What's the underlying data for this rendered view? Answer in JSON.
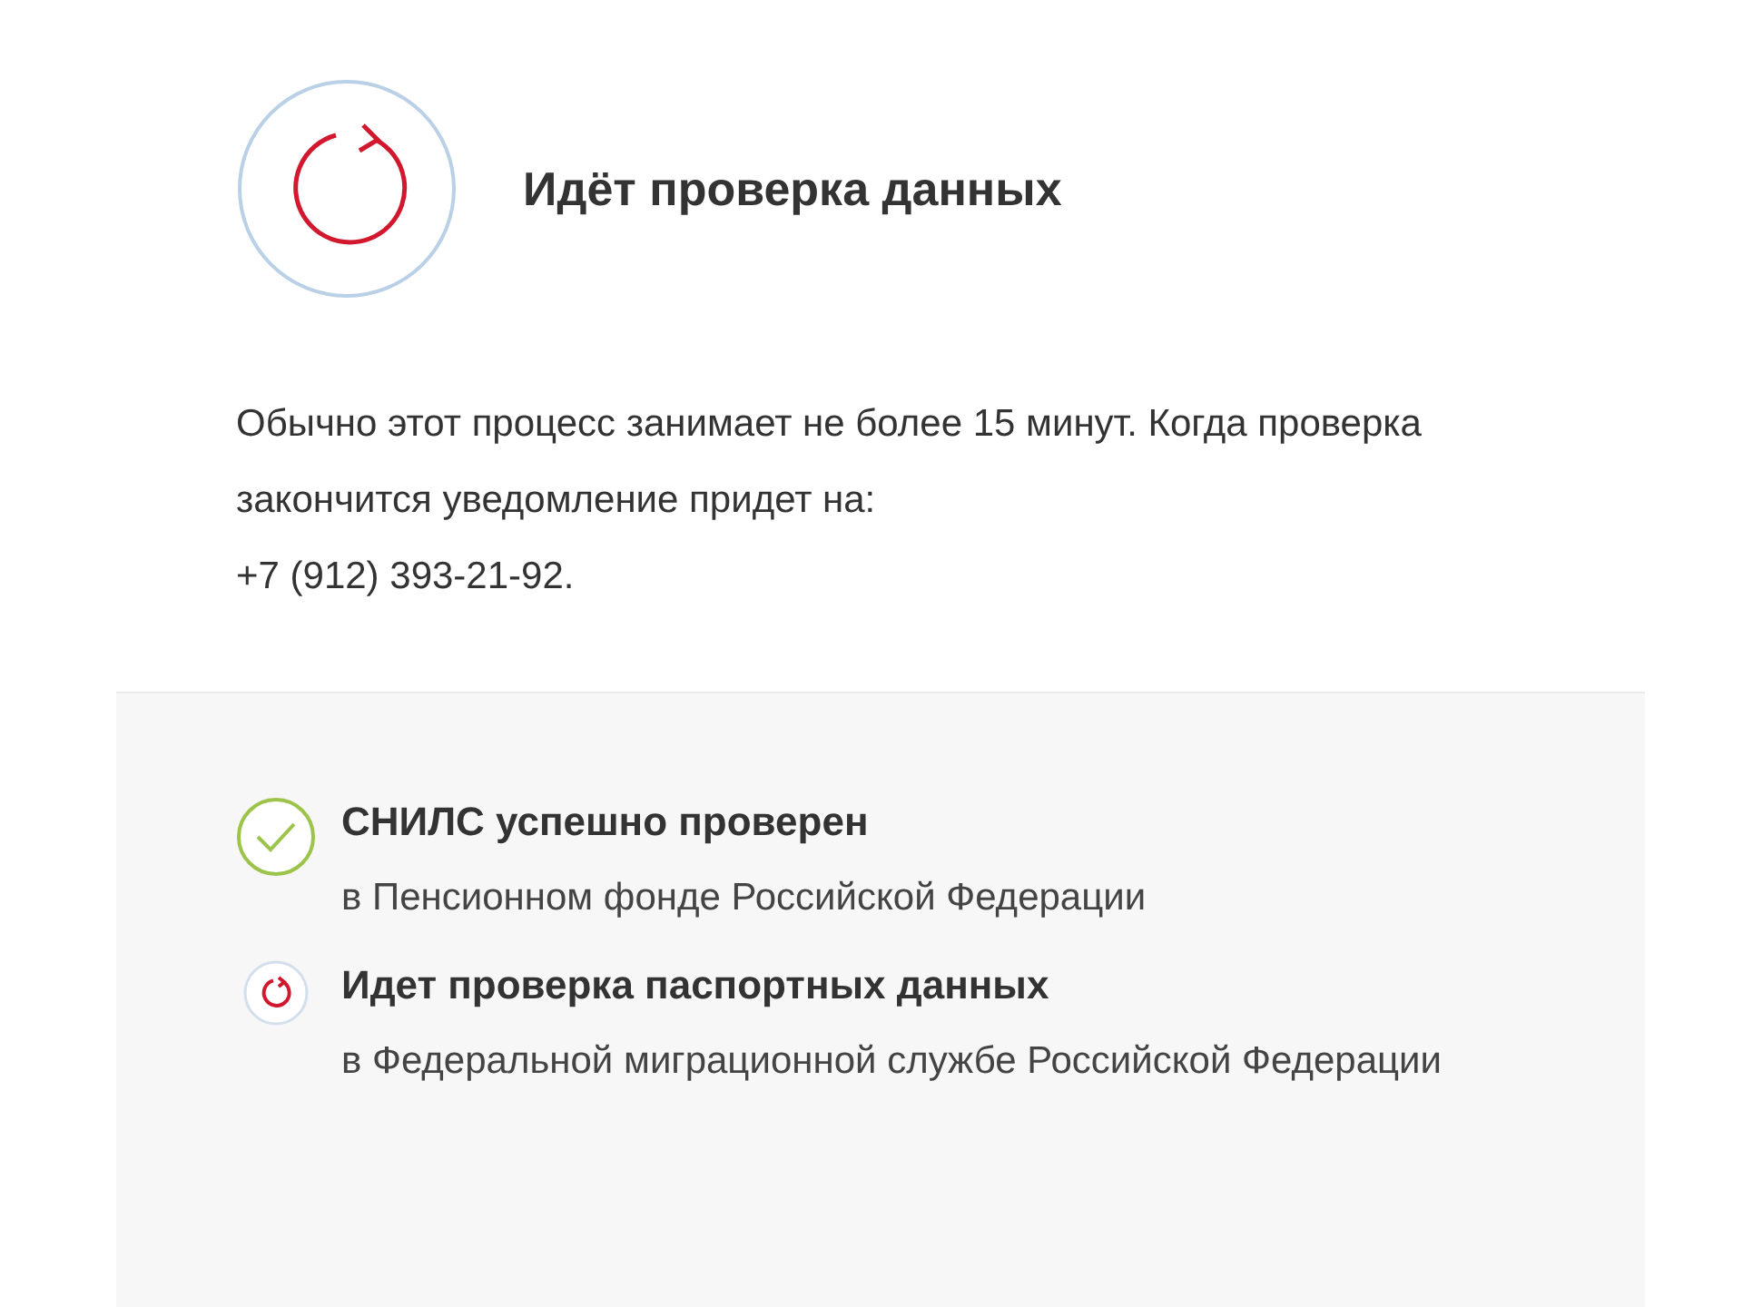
{
  "header": {
    "title": "Идёт проверка данных"
  },
  "message": {
    "text": "Обычно этот процесс занимает не более 15 минут. Когда проверка закончится уведомление придет на:",
    "phone": "+7 (912) 393-21-92."
  },
  "checks": [
    {
      "kind": "done",
      "title": "СНИЛС успешно проверен",
      "detail": "в Пенсионном фонде Российской Федерации"
    },
    {
      "kind": "pending",
      "title": "Идет проверка паспортных данных",
      "detail": "в Федеральной миграционной службе Российской Федерации"
    }
  ]
}
